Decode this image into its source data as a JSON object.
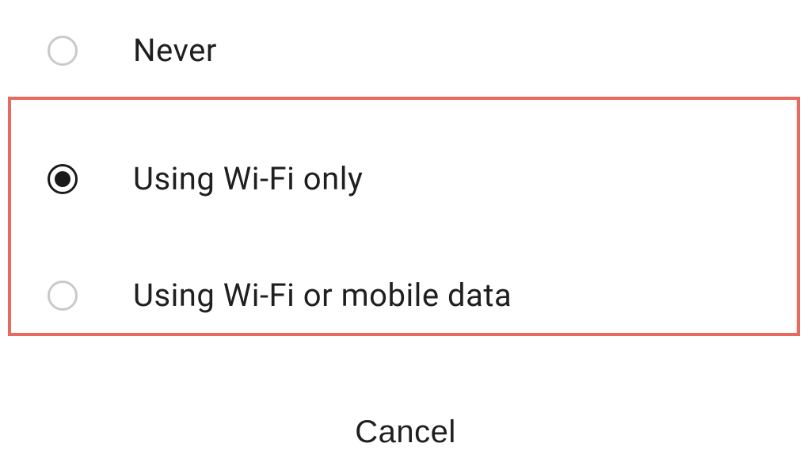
{
  "options": {
    "never": {
      "label": "Never",
      "selected": false
    },
    "wifi_only": {
      "label": "Using Wi-Fi only",
      "selected": true
    },
    "wifi_or_mobile": {
      "label": "Using Wi-Fi or mobile data",
      "selected": false
    }
  },
  "actions": {
    "cancel_label": "Cancel"
  },
  "highlight_color": "#e86a5e"
}
